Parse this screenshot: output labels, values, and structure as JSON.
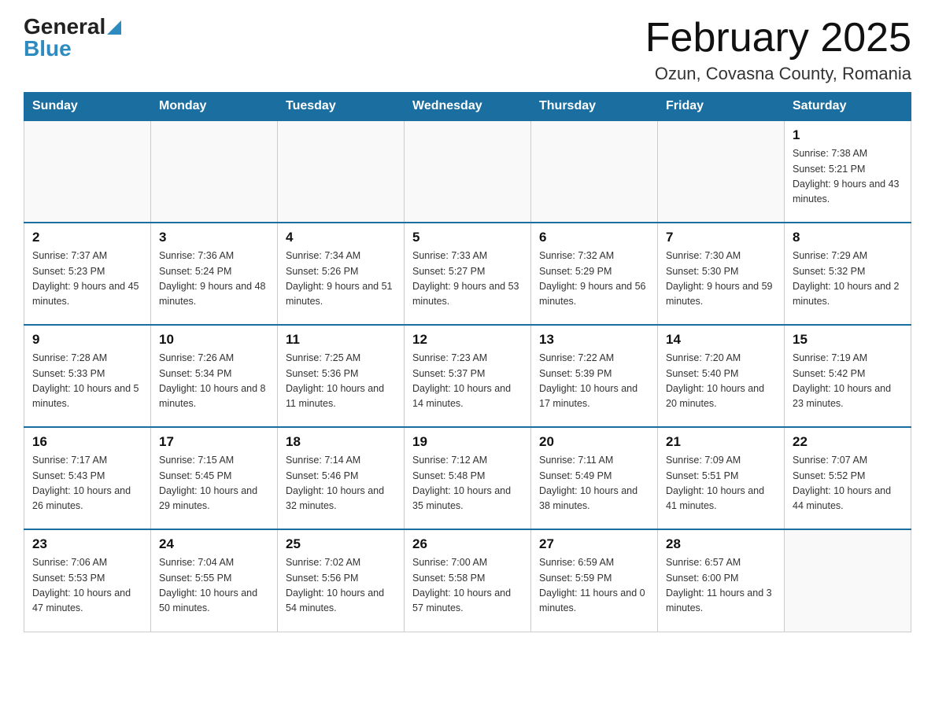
{
  "header": {
    "logo_general": "General",
    "logo_blue": "Blue",
    "month_title": "February 2025",
    "subtitle": "Ozun, Covasna County, Romania"
  },
  "weekdays": [
    "Sunday",
    "Monday",
    "Tuesday",
    "Wednesday",
    "Thursday",
    "Friday",
    "Saturday"
  ],
  "weeks": [
    [
      {
        "day": "",
        "sunrise": "",
        "sunset": "",
        "daylight": ""
      },
      {
        "day": "",
        "sunrise": "",
        "sunset": "",
        "daylight": ""
      },
      {
        "day": "",
        "sunrise": "",
        "sunset": "",
        "daylight": ""
      },
      {
        "day": "",
        "sunrise": "",
        "sunset": "",
        "daylight": ""
      },
      {
        "day": "",
        "sunrise": "",
        "sunset": "",
        "daylight": ""
      },
      {
        "day": "",
        "sunrise": "",
        "sunset": "",
        "daylight": ""
      },
      {
        "day": "1",
        "sunrise": "Sunrise: 7:38 AM",
        "sunset": "Sunset: 5:21 PM",
        "daylight": "Daylight: 9 hours and 43 minutes."
      }
    ],
    [
      {
        "day": "2",
        "sunrise": "Sunrise: 7:37 AM",
        "sunset": "Sunset: 5:23 PM",
        "daylight": "Daylight: 9 hours and 45 minutes."
      },
      {
        "day": "3",
        "sunrise": "Sunrise: 7:36 AM",
        "sunset": "Sunset: 5:24 PM",
        "daylight": "Daylight: 9 hours and 48 minutes."
      },
      {
        "day": "4",
        "sunrise": "Sunrise: 7:34 AM",
        "sunset": "Sunset: 5:26 PM",
        "daylight": "Daylight: 9 hours and 51 minutes."
      },
      {
        "day": "5",
        "sunrise": "Sunrise: 7:33 AM",
        "sunset": "Sunset: 5:27 PM",
        "daylight": "Daylight: 9 hours and 53 minutes."
      },
      {
        "day": "6",
        "sunrise": "Sunrise: 7:32 AM",
        "sunset": "Sunset: 5:29 PM",
        "daylight": "Daylight: 9 hours and 56 minutes."
      },
      {
        "day": "7",
        "sunrise": "Sunrise: 7:30 AM",
        "sunset": "Sunset: 5:30 PM",
        "daylight": "Daylight: 9 hours and 59 minutes."
      },
      {
        "day": "8",
        "sunrise": "Sunrise: 7:29 AM",
        "sunset": "Sunset: 5:32 PM",
        "daylight": "Daylight: 10 hours and 2 minutes."
      }
    ],
    [
      {
        "day": "9",
        "sunrise": "Sunrise: 7:28 AM",
        "sunset": "Sunset: 5:33 PM",
        "daylight": "Daylight: 10 hours and 5 minutes."
      },
      {
        "day": "10",
        "sunrise": "Sunrise: 7:26 AM",
        "sunset": "Sunset: 5:34 PM",
        "daylight": "Daylight: 10 hours and 8 minutes."
      },
      {
        "day": "11",
        "sunrise": "Sunrise: 7:25 AM",
        "sunset": "Sunset: 5:36 PM",
        "daylight": "Daylight: 10 hours and 11 minutes."
      },
      {
        "day": "12",
        "sunrise": "Sunrise: 7:23 AM",
        "sunset": "Sunset: 5:37 PM",
        "daylight": "Daylight: 10 hours and 14 minutes."
      },
      {
        "day": "13",
        "sunrise": "Sunrise: 7:22 AM",
        "sunset": "Sunset: 5:39 PM",
        "daylight": "Daylight: 10 hours and 17 minutes."
      },
      {
        "day": "14",
        "sunrise": "Sunrise: 7:20 AM",
        "sunset": "Sunset: 5:40 PM",
        "daylight": "Daylight: 10 hours and 20 minutes."
      },
      {
        "day": "15",
        "sunrise": "Sunrise: 7:19 AM",
        "sunset": "Sunset: 5:42 PM",
        "daylight": "Daylight: 10 hours and 23 minutes."
      }
    ],
    [
      {
        "day": "16",
        "sunrise": "Sunrise: 7:17 AM",
        "sunset": "Sunset: 5:43 PM",
        "daylight": "Daylight: 10 hours and 26 minutes."
      },
      {
        "day": "17",
        "sunrise": "Sunrise: 7:15 AM",
        "sunset": "Sunset: 5:45 PM",
        "daylight": "Daylight: 10 hours and 29 minutes."
      },
      {
        "day": "18",
        "sunrise": "Sunrise: 7:14 AM",
        "sunset": "Sunset: 5:46 PM",
        "daylight": "Daylight: 10 hours and 32 minutes."
      },
      {
        "day": "19",
        "sunrise": "Sunrise: 7:12 AM",
        "sunset": "Sunset: 5:48 PM",
        "daylight": "Daylight: 10 hours and 35 minutes."
      },
      {
        "day": "20",
        "sunrise": "Sunrise: 7:11 AM",
        "sunset": "Sunset: 5:49 PM",
        "daylight": "Daylight: 10 hours and 38 minutes."
      },
      {
        "day": "21",
        "sunrise": "Sunrise: 7:09 AM",
        "sunset": "Sunset: 5:51 PM",
        "daylight": "Daylight: 10 hours and 41 minutes."
      },
      {
        "day": "22",
        "sunrise": "Sunrise: 7:07 AM",
        "sunset": "Sunset: 5:52 PM",
        "daylight": "Daylight: 10 hours and 44 minutes."
      }
    ],
    [
      {
        "day": "23",
        "sunrise": "Sunrise: 7:06 AM",
        "sunset": "Sunset: 5:53 PM",
        "daylight": "Daylight: 10 hours and 47 minutes."
      },
      {
        "day": "24",
        "sunrise": "Sunrise: 7:04 AM",
        "sunset": "Sunset: 5:55 PM",
        "daylight": "Daylight: 10 hours and 50 minutes."
      },
      {
        "day": "25",
        "sunrise": "Sunrise: 7:02 AM",
        "sunset": "Sunset: 5:56 PM",
        "daylight": "Daylight: 10 hours and 54 minutes."
      },
      {
        "day": "26",
        "sunrise": "Sunrise: 7:00 AM",
        "sunset": "Sunset: 5:58 PM",
        "daylight": "Daylight: 10 hours and 57 minutes."
      },
      {
        "day": "27",
        "sunrise": "Sunrise: 6:59 AM",
        "sunset": "Sunset: 5:59 PM",
        "daylight": "Daylight: 11 hours and 0 minutes."
      },
      {
        "day": "28",
        "sunrise": "Sunrise: 6:57 AM",
        "sunset": "Sunset: 6:00 PM",
        "daylight": "Daylight: 11 hours and 3 minutes."
      },
      {
        "day": "",
        "sunrise": "",
        "sunset": "",
        "daylight": ""
      }
    ]
  ]
}
